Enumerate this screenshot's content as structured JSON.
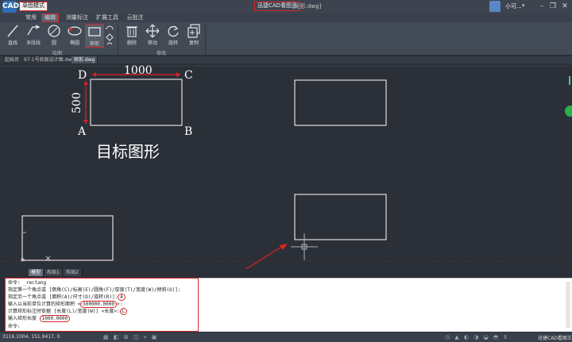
{
  "titlebar": {
    "mode": "草图模式",
    "app_title": "迅捷CAD看图王",
    "file_title": "[矩形.dwg]",
    "user": "小可...",
    "logo": "CAD"
  },
  "menu": [
    "常用",
    "编辑",
    "测量标注",
    "扩展工具",
    "云批注"
  ],
  "ribbon": {
    "tools": [
      {
        "label": "直线"
      },
      {
        "label": "多段线"
      },
      {
        "label": "圆"
      },
      {
        "label": "椭圆"
      },
      {
        "label": "矩形"
      },
      {
        "label": "删除"
      },
      {
        "label": "移动"
      },
      {
        "label": "旋转"
      },
      {
        "label": "复制"
      }
    ],
    "groups": {
      "draw": "绘图",
      "modify": "修改"
    }
  },
  "doc_tabs": [
    "起始页",
    "97-1号底板设计图.dwg",
    "矩形.dwg"
  ],
  "canvas": {
    "labels": {
      "d": "D",
      "c": "C",
      "a": "A",
      "b": "B",
      "width": "1000",
      "height": "500",
      "caption": "目标图形"
    }
  },
  "layout_tabs": [
    "模型",
    "布局1",
    "布局2"
  ],
  "command": {
    "lines": [
      {
        "text": "命令: _rectang"
      },
      {
        "text": "指定第一个角点或 [倒角(C)/标高(E)/圆角(F)/厚度(T)/宽度(W)/倾斜(O)]:"
      },
      {
        "text": "指定另一个角点或 [面积(A)/尺寸(D)/旋转(R)]:",
        "hl": "A"
      },
      {
        "text": "输入以当前单位计算的矩形面积 <",
        "hl": "500000.0000",
        "tail": ">:"
      },
      {
        "text": "计算矩形标注时依据 [长度(L)/宽度(W)] <长度>:",
        "hl": "L"
      },
      {
        "text": "输入矩形长度 ",
        "hl": "1000.0000",
        "tail": ""
      },
      {
        "text": "命令:"
      }
    ]
  },
  "status": {
    "coords": "3116.1004, 151.9417, 0",
    "brand": "迅捷CAD看图王"
  },
  "colors": {
    "highlight": "#d9262c",
    "accent": "#2f6fb5"
  }
}
